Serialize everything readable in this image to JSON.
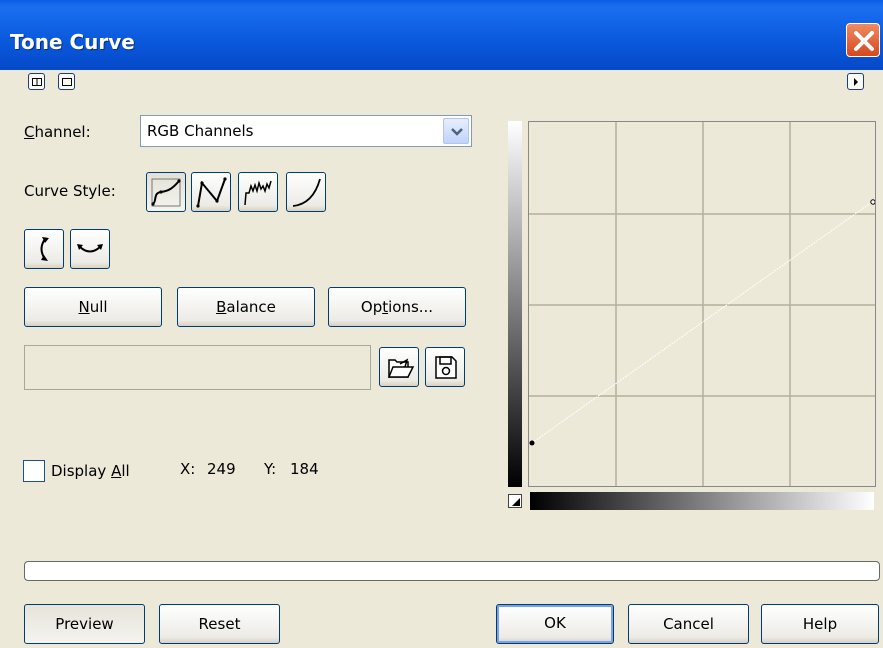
{
  "window": {
    "title": "Tone Curve"
  },
  "channel": {
    "label_accel": "C",
    "label_rest": "hannel:",
    "value": "RGB Channels"
  },
  "curve_style": {
    "label": "Curve Style:"
  },
  "buttons": {
    "null_accel": "N",
    "null_rest": "ull",
    "balance_accel": "B",
    "balance_rest": "alance",
    "options_pre": "Op",
    "options_accel": "t",
    "options_rest": "ions...",
    "preview": "Preview",
    "reset": "Reset",
    "ok": "OK",
    "cancel": "Cancel",
    "help": "Help"
  },
  "display_all": {
    "label_pre": "Display ",
    "label_accel": "A",
    "label_rest": "ll",
    "checked": false
  },
  "coords": {
    "x_label": "X:",
    "x_value": "249",
    "y_label": "Y:",
    "y_value": "184"
  },
  "icons": {
    "restore": "restore-icon",
    "collapse": "collapse-icon",
    "flyout": "flyout-arrow-icon",
    "curve_smooth": "smooth-curve-icon",
    "curve_linear": "linear-curve-icon",
    "curve_freehand": "freehand-curve-icon",
    "curve_gamma": "gamma-curve-icon",
    "flip_vertical": "flip-vertical-icon",
    "flip_horizontal": "flip-horizontal-icon",
    "open": "open-folder-icon",
    "save": "save-disk-icon"
  },
  "colors": {
    "title_bar": "#0a58dc",
    "close": "#d6481e",
    "background": "#ece9d8"
  },
  "progress": {
    "value": 0
  }
}
